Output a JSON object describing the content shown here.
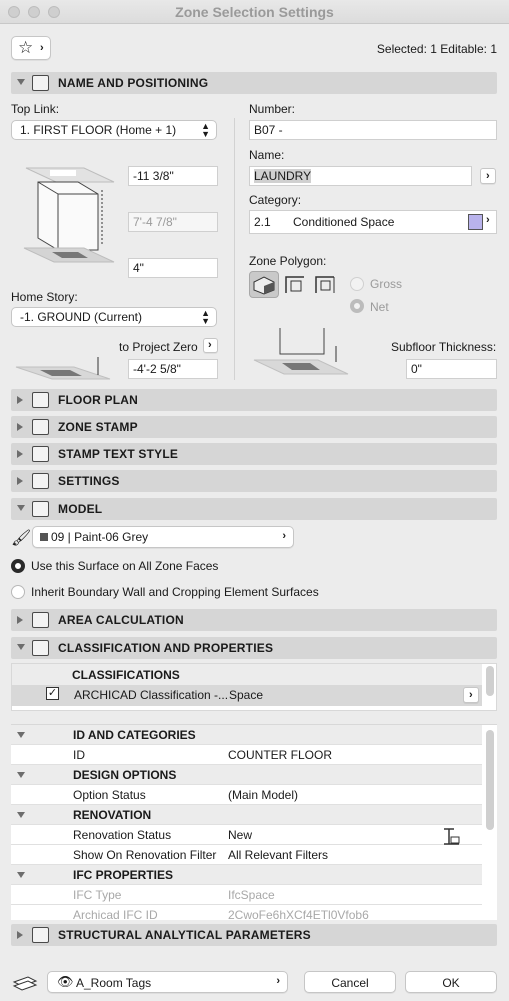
{
  "window": {
    "title": "Zone Selection Settings"
  },
  "header": {
    "selected_info": "Selected: 1 Editable: 1"
  },
  "sections": {
    "name_positioning": "NAME AND POSITIONING",
    "floor_plan": "FLOOR PLAN",
    "zone_stamp": "ZONE STAMP",
    "stamp_text_style": "STAMP TEXT STYLE",
    "settings": "SETTINGS",
    "model": "MODEL",
    "area_calculation": "AREA CALCULATION",
    "classification": "CLASSIFICATION AND PROPERTIES",
    "structural": "STRUCTURAL ANALYTICAL PARAMETERS"
  },
  "positioning": {
    "top_link_label": "Top Link:",
    "top_link_value": "1. FIRST FLOOR (Home + 1)",
    "top_offset": "-11 3/8\"",
    "height": "7'-4 7/8\"",
    "bottom_offset": "4\"",
    "home_story_label": "Home Story:",
    "home_story_value": "-1. GROUND (Current)",
    "to_project_zero_label": "to Project Zero",
    "project_zero_value": "-4'-2 5/8\"",
    "number_label": "Number:",
    "number_value": "B07 -",
    "name_label": "Name:",
    "name_value": "LAUNDRY",
    "category_label": "Category:",
    "category_code": "2.1",
    "category_name": "Conditioned Space",
    "category_color": "#b9b3ec",
    "zone_polygon_label": "Zone Polygon:",
    "gross_label": "Gross",
    "net_label": "Net",
    "subfloor_label": "Subfloor Thickness:",
    "subfloor_value": "0\""
  },
  "model": {
    "surface_value": "09 | Paint-06 Grey",
    "option1": "Use this Surface on All Zone Faces",
    "option2": "Inherit Boundary Wall and Cropping Element Surfaces"
  },
  "classifications": {
    "header": "CLASSIFICATIONS",
    "row_name": "ARCHICAD Classification -...",
    "row_value": "Space"
  },
  "properties": {
    "groups": [
      {
        "title": "ID AND CATEGORIES",
        "rows": [
          {
            "name": "ID",
            "value": "COUNTER FLOOR"
          }
        ]
      },
      {
        "title": "DESIGN OPTIONS",
        "rows": [
          {
            "name": "Option Status",
            "value": "(Main Model)"
          }
        ]
      },
      {
        "title": "RENOVATION",
        "rows": [
          {
            "name": "Renovation Status",
            "value": "New"
          },
          {
            "name": "Show On Renovation Filter",
            "value": "All Relevant Filters"
          }
        ]
      },
      {
        "title": "IFC PROPERTIES",
        "rows": [
          {
            "name": "IFC Type",
            "value": "IfcSpace"
          },
          {
            "name": "Archicad IFC ID",
            "value": "2CwoFe6hXCf4ETl0Vfob6"
          }
        ]
      }
    ]
  },
  "footer": {
    "layer_value": "A_Room Tags",
    "cancel_label": "Cancel",
    "ok_label": "OK"
  }
}
